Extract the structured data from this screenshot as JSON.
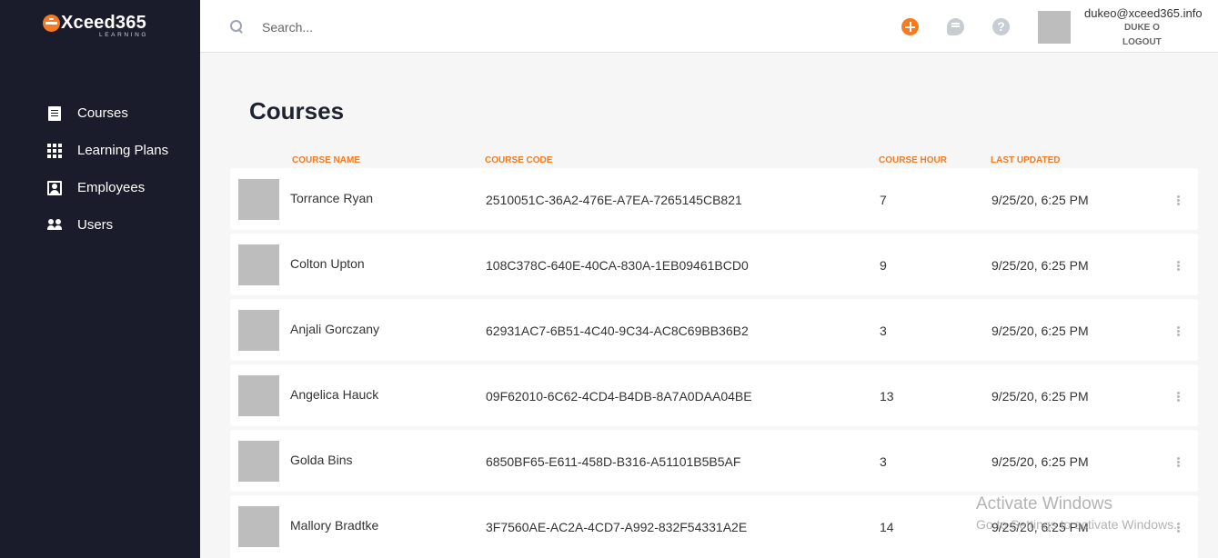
{
  "brand": {
    "name": "Xceed365",
    "tagline": "LEARNING"
  },
  "sidebar": {
    "items": [
      {
        "label": "Courses",
        "icon": "document-icon"
      },
      {
        "label": "Learning Plans",
        "icon": "grid-icon"
      },
      {
        "label": "Employees",
        "icon": "contact-card-icon"
      },
      {
        "label": "Users",
        "icon": "users-icon"
      }
    ]
  },
  "header": {
    "search_placeholder": "Search...",
    "help_glyph": "?",
    "user": {
      "email": "dukeo@xceed365.info",
      "name": "DUKE O",
      "logout_label": "LOGOUT"
    }
  },
  "main": {
    "title": "Courses",
    "columns": {
      "name": "COURSE NAME",
      "code": "COURSE CODE",
      "hour": "COURSE HOUR",
      "updated": "LAST UPDATED"
    },
    "rows": [
      {
        "name": "Torrance Ryan",
        "code": "2510051C-36A2-476E-A7EA-7265145CB821",
        "hour": "7",
        "updated": "9/25/20, 6:25 PM"
      },
      {
        "name": "Colton Upton",
        "code": "108C378C-640E-40CA-830A-1EB09461BCD0",
        "hour": "9",
        "updated": "9/25/20, 6:25 PM"
      },
      {
        "name": "Anjali Gorczany",
        "code": "62931AC7-6B51-4C40-9C34-AC8C69BB36B2",
        "hour": "3",
        "updated": "9/25/20, 6:25 PM"
      },
      {
        "name": "Angelica Hauck",
        "code": "09F62010-6C62-4CD4-B4DB-8A7A0DAA04BE",
        "hour": "13",
        "updated": "9/25/20, 6:25 PM"
      },
      {
        "name": "Golda Bins",
        "code": "6850BF65-E611-458D-B316-A51101B5B5AF",
        "hour": "3",
        "updated": "9/25/20, 6:25 PM"
      },
      {
        "name": "Mallory Bradtke",
        "code": "3F7560AE-AC2A-4CD7-A992-832F54331A2E",
        "hour": "14",
        "updated": "9/25/20, 6:25 PM"
      }
    ]
  },
  "watermark": {
    "title": "Activate Windows",
    "subtitle": "Go to Settings to activate Windows."
  },
  "colors": {
    "accent": "#f47b20",
    "sidebar_bg": "#1b1c2b",
    "page_bg": "#f6f6f6"
  }
}
